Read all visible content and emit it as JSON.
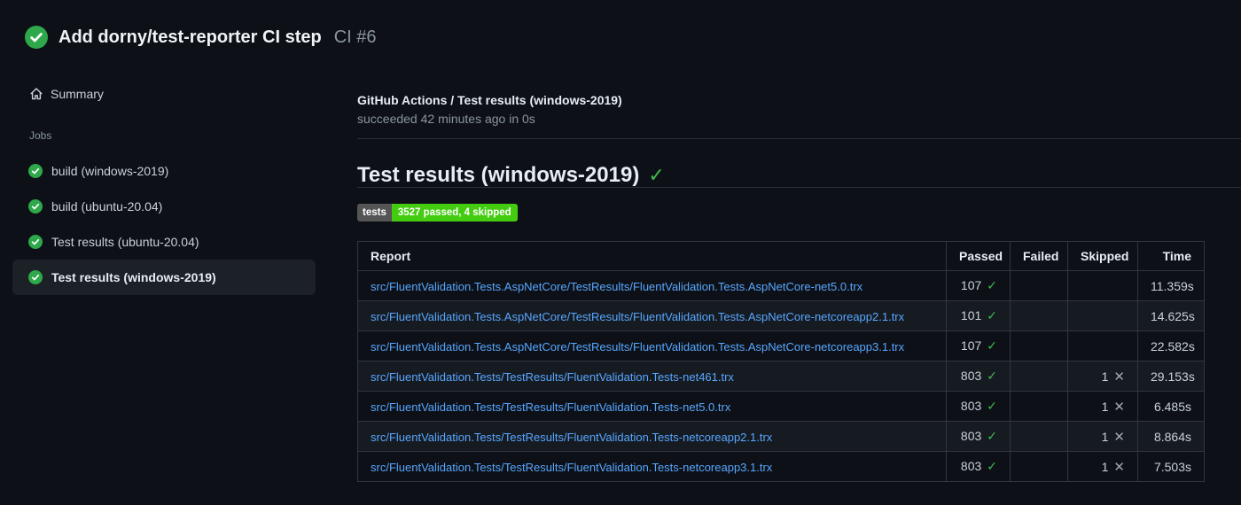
{
  "icons": {
    "check": "✓",
    "cross": "✕"
  },
  "header": {
    "title": "Add dorny/test-reporter CI step",
    "run_number": "CI #6"
  },
  "sidebar": {
    "summary": "Summary",
    "jobs_heading": "Jobs",
    "jobs": [
      {
        "label": "build (windows-2019)",
        "selected": false
      },
      {
        "label": "build (ubuntu-20.04)",
        "selected": false
      },
      {
        "label": "Test results (ubuntu-20.04)",
        "selected": false
      },
      {
        "label": "Test results (windows-2019)",
        "selected": true
      }
    ]
  },
  "main": {
    "job_title": "GitHub Actions / Test results (windows-2019)",
    "status_line": "succeeded 42 minutes ago in 0s",
    "heading": "Test results (windows-2019)",
    "heading_check": "✓",
    "badge": {
      "label": "tests",
      "value": "3527 passed, 4 skipped",
      "label_bg": "#555555",
      "value_bg": "#44cc11"
    },
    "table": {
      "headers": [
        "Report",
        "Passed",
        "Failed",
        "Skipped",
        "Time"
      ],
      "rows": [
        {
          "report": "src/FluentValidation.Tests.AspNetCore/TestResults/FluentValidation.Tests.AspNetCore-net5.0.trx",
          "passed": "107",
          "passed_icon": "✓",
          "failed": "",
          "failed_icon": "",
          "skipped": "",
          "skipped_icon": "",
          "time": "11.359s"
        },
        {
          "report": "src/FluentValidation.Tests.AspNetCore/TestResults/FluentValidation.Tests.AspNetCore-netcoreapp2.1.trx",
          "passed": "101",
          "passed_icon": "✓",
          "failed": "",
          "failed_icon": "",
          "skipped": "",
          "skipped_icon": "",
          "time": "14.625s"
        },
        {
          "report": "src/FluentValidation.Tests.AspNetCore/TestResults/FluentValidation.Tests.AspNetCore-netcoreapp3.1.trx",
          "passed": "107",
          "passed_icon": "✓",
          "failed": "",
          "failed_icon": "",
          "skipped": "",
          "skipped_icon": "",
          "time": "22.582s"
        },
        {
          "report": "src/FluentValidation.Tests/TestResults/FluentValidation.Tests-net461.trx",
          "passed": "803",
          "passed_icon": "✓",
          "failed": "",
          "failed_icon": "",
          "skipped": "1",
          "skipped_icon": "✕",
          "time": "29.153s"
        },
        {
          "report": "src/FluentValidation.Tests/TestResults/FluentValidation.Tests-net5.0.trx",
          "passed": "803",
          "passed_icon": "✓",
          "failed": "",
          "failed_icon": "",
          "skipped": "1",
          "skipped_icon": "✕",
          "time": "6.485s"
        },
        {
          "report": "src/FluentValidation.Tests/TestResults/FluentValidation.Tests-netcoreapp2.1.trx",
          "passed": "803",
          "passed_icon": "✓",
          "failed": "",
          "failed_icon": "",
          "skipped": "1",
          "skipped_icon": "✕",
          "time": "8.864s"
        },
        {
          "report": "src/FluentValidation.Tests/TestResults/FluentValidation.Tests-netcoreapp3.1.trx",
          "passed": "803",
          "passed_icon": "✓",
          "failed": "",
          "failed_icon": "",
          "skipped": "1",
          "skipped_icon": "✕",
          "time": "7.503s"
        }
      ]
    }
  },
  "colors": {
    "accent_green": "#3fb950",
    "badge_green": "#44cc11",
    "badge_gray": "#555555",
    "link_blue": "#58a6ff",
    "background": "#0d1117",
    "row_stripe": "#161b22"
  }
}
